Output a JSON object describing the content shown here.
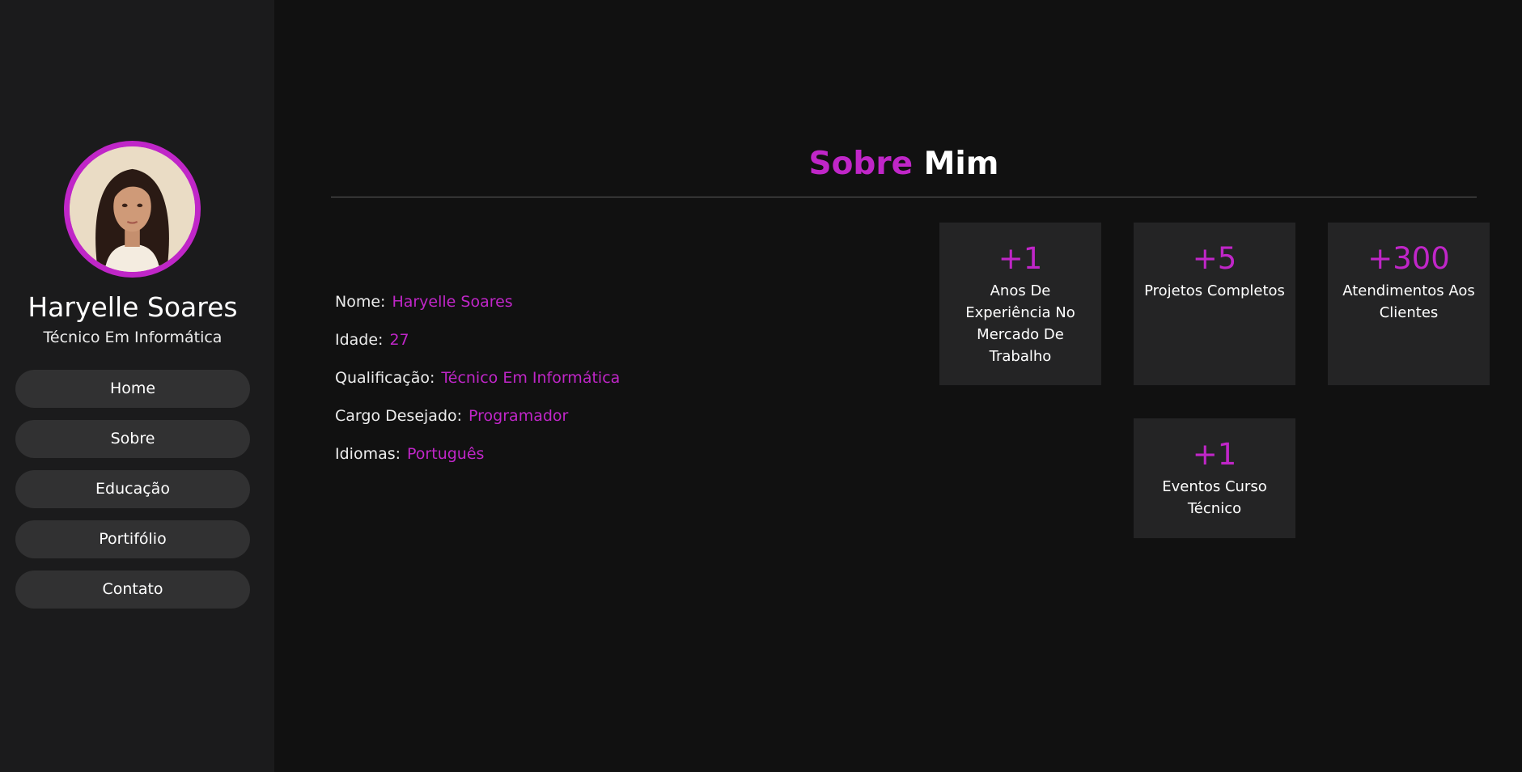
{
  "profile": {
    "name": "Haryelle Soares",
    "role": "Técnico Em Informática"
  },
  "nav": {
    "items": [
      {
        "label": "Home"
      },
      {
        "label": "Sobre"
      },
      {
        "label": "Educação"
      },
      {
        "label": "Portifólio"
      },
      {
        "label": "Contato"
      }
    ]
  },
  "section": {
    "title_accent": "Sobre",
    "title_rest": "Mim"
  },
  "info": [
    {
      "key": "Nome:",
      "value": "Haryelle Soares"
    },
    {
      "key": "Idade:",
      "value": "27"
    },
    {
      "key": "Qualificação:",
      "value": "Técnico Em Informática"
    },
    {
      "key": "Cargo Desejado:",
      "value": "Programador"
    },
    {
      "key": "Idiomas:",
      "value": "Português"
    }
  ],
  "stats": [
    {
      "number": "+1",
      "label": "Anos De Experiência No Mercado De Trabalho"
    },
    {
      "number": "+5",
      "label": "Projetos Completos"
    },
    {
      "number": "+300",
      "label": "Atendimentos Aos Clientes"
    },
    {
      "number": "+1",
      "label": "Eventos Curso Técnico"
    }
  ],
  "colors": {
    "accent": "#c026c8",
    "background": "#111111",
    "sidebar": "#1b1b1c",
    "card": "#242425",
    "button": "#313132"
  }
}
